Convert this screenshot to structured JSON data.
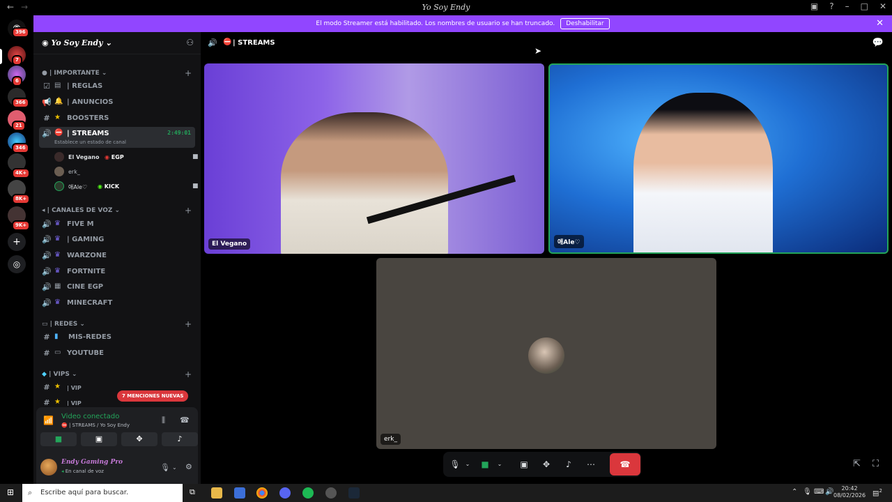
{
  "window": {
    "title": "Yo Soy Endy"
  },
  "server_badges": [
    "396",
    "7",
    "6",
    "366",
    "21",
    "346",
    "4K+",
    "8K+",
    "9K+"
  ],
  "banner": {
    "text": "El modo Streamer está habilitado. Los nombres de usuario se han truncado.",
    "button": "Deshabilitar"
  },
  "server": {
    "name": "Yo Soy Endy"
  },
  "categories": {
    "importante": "| IMPORTANTE",
    "voz": "| CANALES DE VOZ",
    "redes": "| REDES",
    "vips": "| VIPS"
  },
  "channels": {
    "reglas": "| REGLAS",
    "anuncios": "| ANUNCIOS",
    "boosters": "BOOSTERS",
    "streams": "| STREAMS",
    "streams_timer": "2:49:01",
    "streams_status": "Establece un estado de canal",
    "fivem": "FIVE M",
    "gaming": "| GAMING",
    "warzone": "WARZONE",
    "fortnite": "FORTNITE",
    "cineegp": "CINE EGP",
    "minecraft": "MINECRAFT",
    "misredes": "MIS-REDES",
    "youtube": "YOUTUBE",
    "vip1": "| VIP",
    "vip2": "| VIP"
  },
  "voice_users": [
    {
      "name": "El Vegano",
      "tag": "EGP"
    },
    {
      "name": "erk_",
      "tag": ""
    },
    {
      "name": "애Ale♡",
      "tag": "KICK"
    }
  ],
  "mentions": "7 MENCIONES NUEVAS",
  "voice_panel": {
    "status": "Video conectado",
    "location": "| STREAMS / Yo Soy Endy"
  },
  "user_panel": {
    "name": "Endy Gaming Pro",
    "status": "En canal de voz"
  },
  "stage": {
    "channel": "| STREAMS",
    "tiles": [
      "El Vegano",
      "애Ale♡",
      "erk_"
    ]
  },
  "taskbar": {
    "search_placeholder": "Escribe aquí para buscar.",
    "time": "20:42",
    "date": "08/02/2026",
    "notif_count": "2"
  },
  "colors": {
    "banner": "#9146ff",
    "connected": "#23a55a",
    "hangup": "#da373c",
    "badge": "#e53935"
  }
}
